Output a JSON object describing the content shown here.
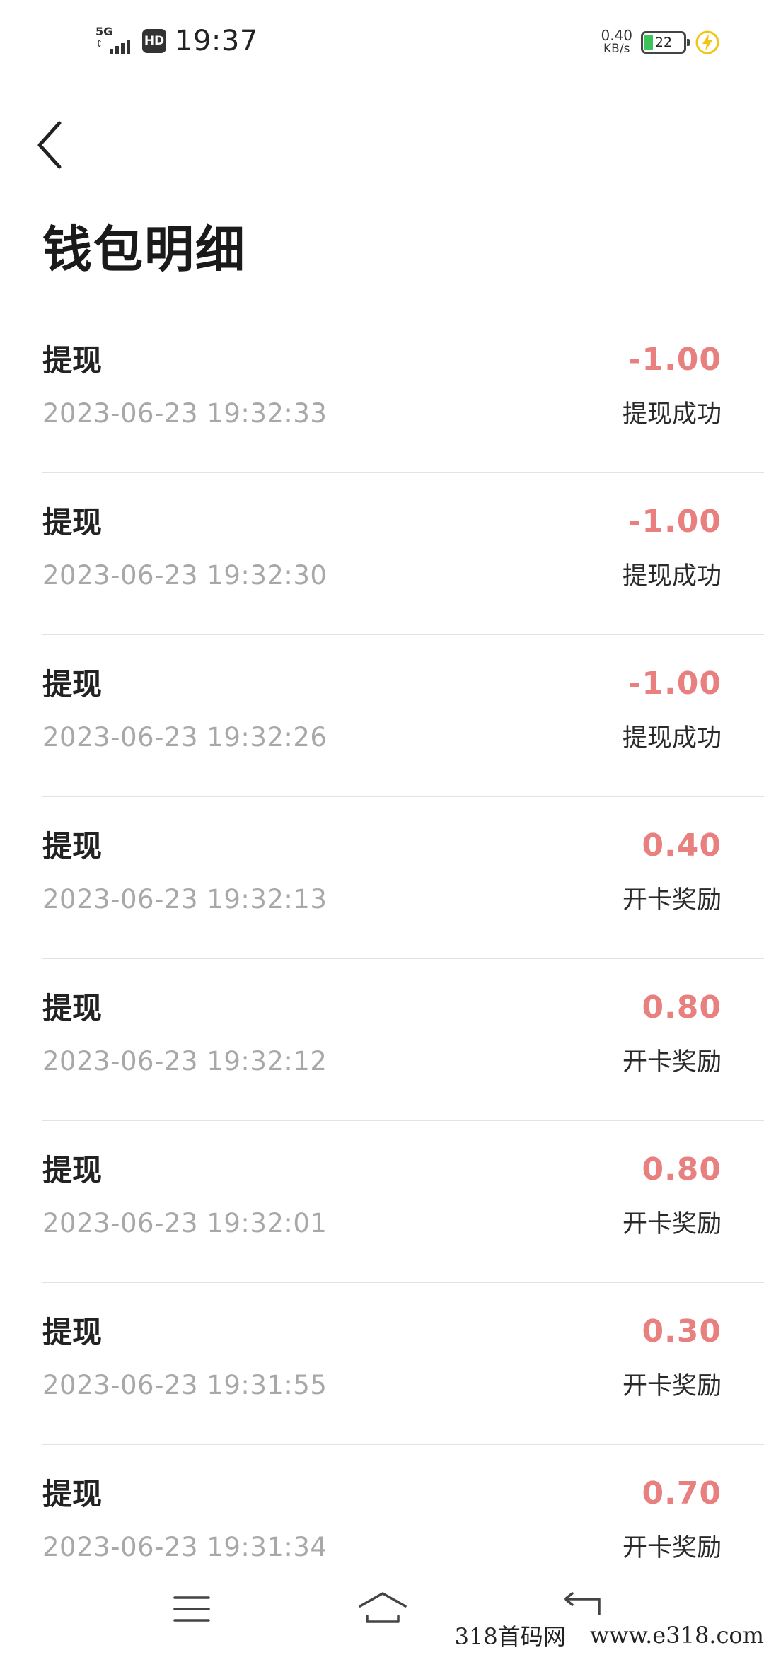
{
  "status_bar": {
    "network": "5G",
    "hd_badge": "HD",
    "time": "19:37",
    "speed_value": "0.40",
    "speed_unit": "KB/s",
    "battery_level": "22",
    "icons": [
      "signal-icon",
      "hd-icon",
      "battery-icon",
      "charging-icon"
    ]
  },
  "header": {
    "back_icon": "chevron-left-icon",
    "title": "钱包明细"
  },
  "colors": {
    "amount": "#e98080",
    "timestamp": "#a8a8a8",
    "divider": "#e3e3e3",
    "battery_fill": "#3cc35a",
    "charge_icon": "#f2c511"
  },
  "records": [
    {
      "name": "提现",
      "time": "2023-06-23 19:32:33",
      "amount": "-1.00",
      "status": "提现成功"
    },
    {
      "name": "提现",
      "time": "2023-06-23 19:32:30",
      "amount": "-1.00",
      "status": "提现成功"
    },
    {
      "name": "提现",
      "time": "2023-06-23 19:32:26",
      "amount": "-1.00",
      "status": "提现成功"
    },
    {
      "name": "提现",
      "time": "2023-06-23 19:32:13",
      "amount": "0.40",
      "status": "开卡奖励"
    },
    {
      "name": "提现",
      "time": "2023-06-23 19:32:12",
      "amount": "0.80",
      "status": "开卡奖励"
    },
    {
      "name": "提现",
      "time": "2023-06-23 19:32:01",
      "amount": "0.80",
      "status": "开卡奖励"
    },
    {
      "name": "提现",
      "time": "2023-06-23 19:31:55",
      "amount": "0.30",
      "status": "开卡奖励"
    },
    {
      "name": "提现",
      "time": "2023-06-23 19:31:34",
      "amount": "0.70",
      "status": "开卡奖励"
    }
  ],
  "nav_bar": {
    "icons": [
      "menu-icon",
      "home-icon",
      "back-icon"
    ]
  },
  "watermark": {
    "site_name": "318首码网",
    "url": "www.e318.com"
  }
}
